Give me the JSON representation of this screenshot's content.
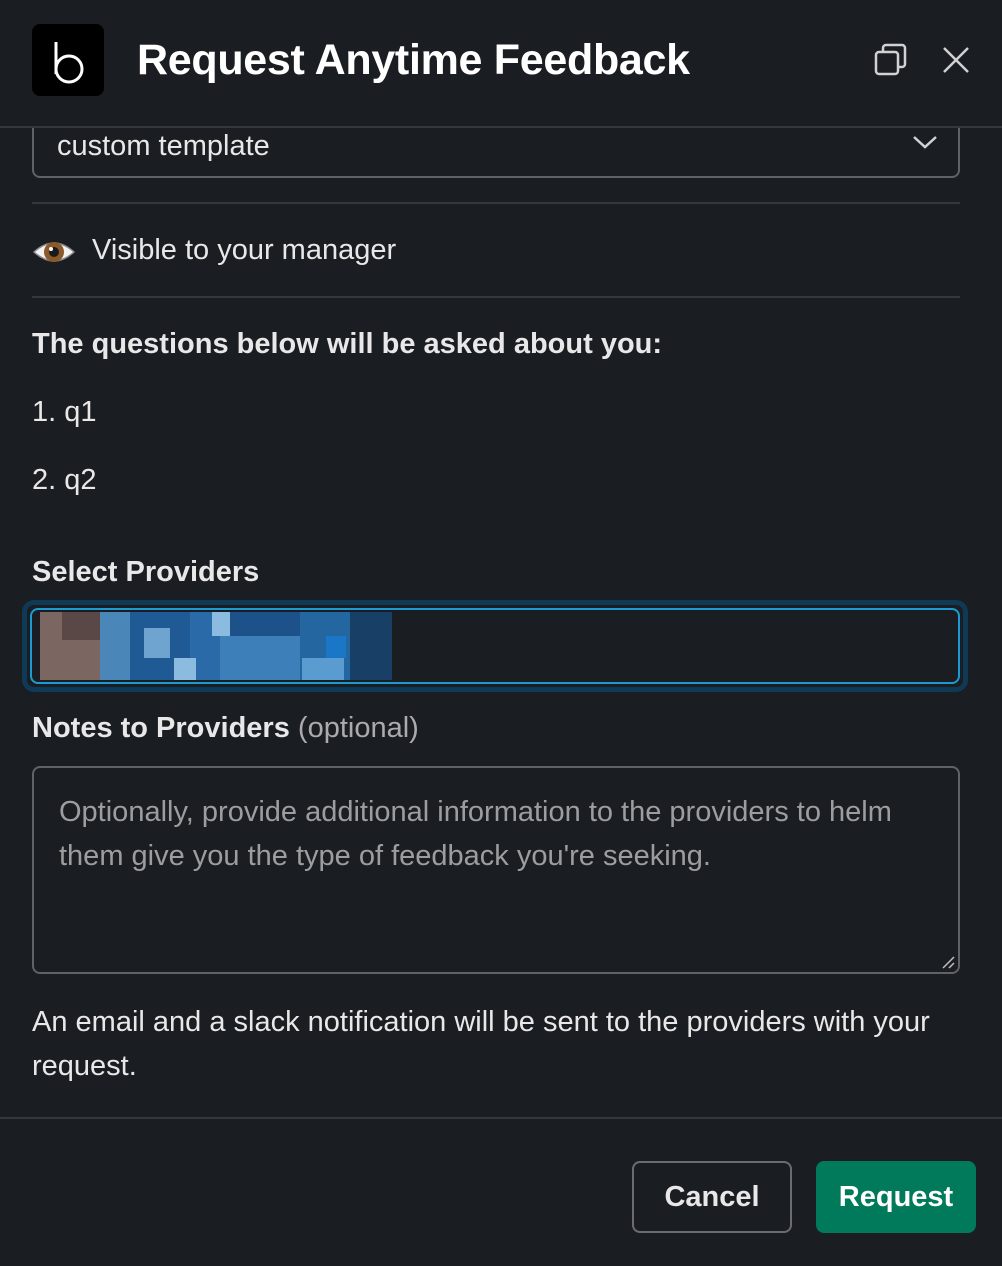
{
  "header": {
    "title": "Request Anytime Feedback",
    "logo_letter": "b",
    "expand_icon": "expand-window-icon",
    "close_icon": "close-icon"
  },
  "template_select": {
    "value": "custom template",
    "icon": "chevron-down-icon"
  },
  "visibility": {
    "icon": "eye-icon",
    "text": "Visible to your manager"
  },
  "questions": {
    "heading": "The questions below will be asked about you:",
    "items": [
      "1. q1",
      "2. q2"
    ]
  },
  "providers": {
    "label": "Select Providers"
  },
  "notes": {
    "label": "Notes to Providers",
    "optional": "(optional)",
    "placeholder": "Optionally, provide additional information to the providers to helm them give you the type of feedback you're seeking."
  },
  "footnote": "An email and a slack notification will be sent to the providers with your request.",
  "footer": {
    "cancel_label": "Cancel",
    "request_label": "Request"
  },
  "colors": {
    "background": "#1a1d21",
    "primary_button": "#007a5a",
    "focus_border": "#1d9bd1"
  }
}
